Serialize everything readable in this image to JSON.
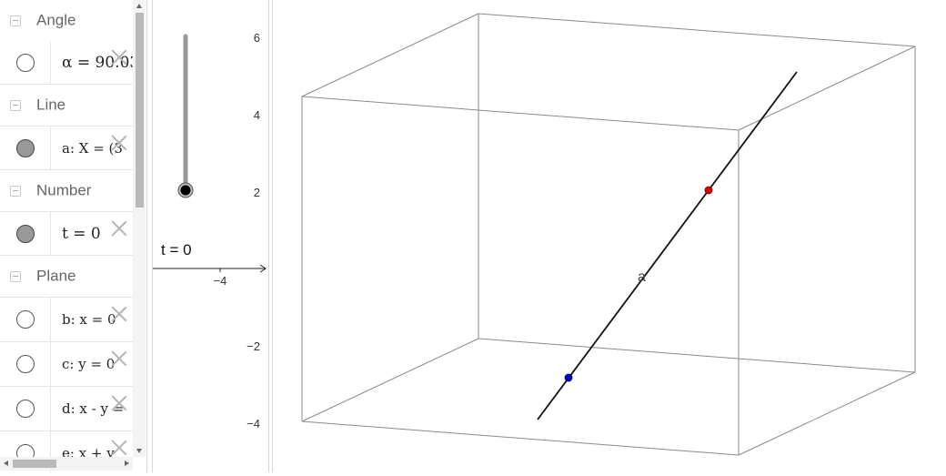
{
  "algebra": {
    "categories": [
      {
        "label": "Angle"
      },
      {
        "label": "Line"
      },
      {
        "label": "Number"
      },
      {
        "label": "Plane"
      }
    ],
    "items": [
      {
        "expr": "α = 90.03",
        "visible": false
      },
      {
        "expr": "a: X = (3",
        "visible": true
      },
      {
        "expr": "t = 0",
        "visible": true
      },
      {
        "expr": "b: x = 0",
        "visible": false
      },
      {
        "expr": "c: y = 0",
        "visible": false
      },
      {
        "expr": "d: x - y =",
        "visible": false
      },
      {
        "expr": "e: x + y",
        "visible": false
      }
    ]
  },
  "graphics2d": {
    "slider_label": "t = 0",
    "y_ticks": [
      "6",
      "4",
      "2",
      "−2",
      "−4"
    ],
    "x_ticks": [
      "−4"
    ]
  },
  "graphics3d": {
    "line_label": "a",
    "point_colors": {
      "point_1": "#e00000",
      "point_2": "#0000cc"
    }
  }
}
